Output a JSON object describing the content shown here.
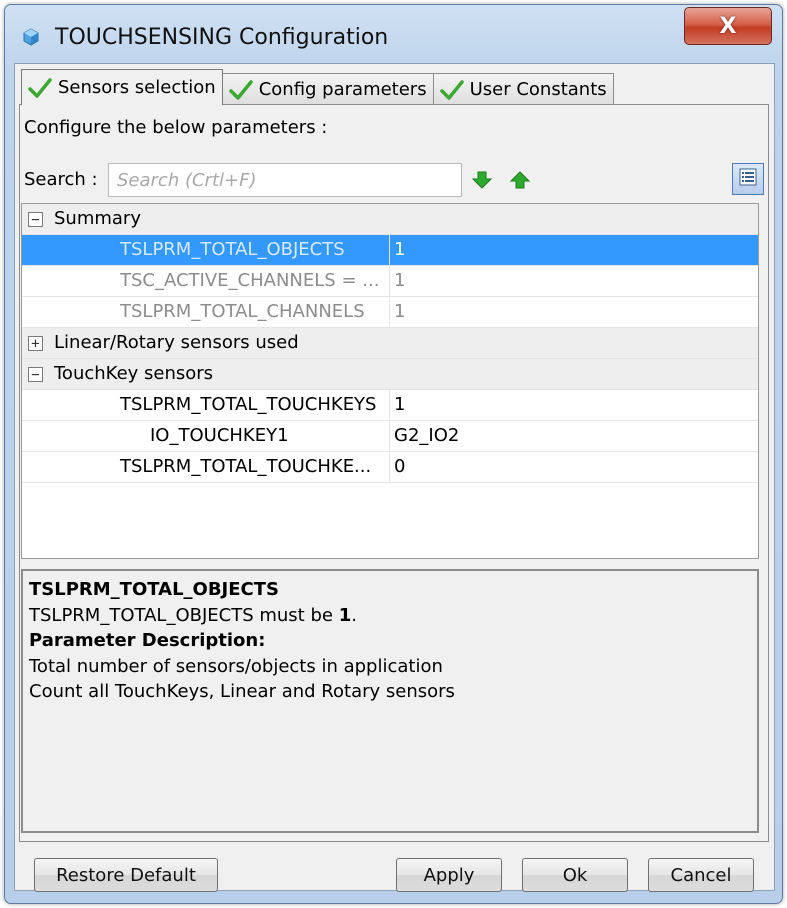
{
  "window": {
    "title": "TOUCHSENSING Configuration",
    "close_label": "X"
  },
  "tabs": [
    {
      "label": "Sensors selection",
      "active": true
    },
    {
      "label": "Config parameters",
      "active": false
    },
    {
      "label": "User Constants",
      "active": false
    }
  ],
  "panel": {
    "configure_label": "Configure the below parameters :",
    "search_label": "Search :",
    "search_placeholder": "Search (Crtl+F)"
  },
  "tree": {
    "summary": {
      "label": "Summary",
      "rows": [
        {
          "name": "TSLPRM_TOTAL_OBJECTS",
          "value": "1"
        },
        {
          "name": "TSC_ACTIVE_CHANNELS = ...",
          "value": "1"
        },
        {
          "name": "TSLPRM_TOTAL_CHANNELS",
          "value": "1"
        }
      ]
    },
    "linear_rotary": {
      "label": "Linear/Rotary sensors used"
    },
    "touchkey": {
      "label": "TouchKey sensors",
      "rows": [
        {
          "name": "TSLPRM_TOTAL_TOUCHKEYS",
          "value": "1"
        },
        {
          "name": "IO_TOUCHKEY1",
          "value": "G2_IO2"
        },
        {
          "name": "TSLPRM_TOTAL_TOUCHKE...",
          "value": "0"
        }
      ]
    }
  },
  "description": {
    "title": "TSLPRM_TOTAL_OBJECTS",
    "constraint_prefix": "TSLPRM_TOTAL_OBJECTS must be ",
    "constraint_value": "1",
    "constraint_suffix": ".",
    "heading": "Parameter Description:",
    "line1": "Total number of sensors/objects in application",
    "line2": "Count all TouchKeys, Linear and Rotary sensors"
  },
  "buttons": {
    "restore": "Restore Default",
    "apply": "Apply",
    "ok": "Ok",
    "cancel": "Cancel"
  },
  "colors": {
    "selection": "#3399ff",
    "check_green": "#3aa832",
    "arrow_green": "#2eaa2e"
  }
}
